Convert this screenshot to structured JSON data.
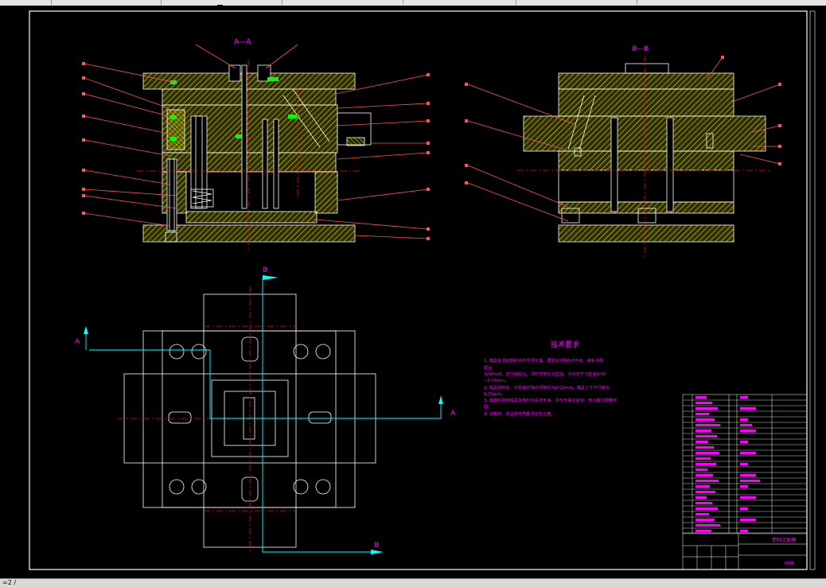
{
  "status": {
    "coord_text": "=2 /"
  },
  "sections": {
    "aa_label": "A—A",
    "bb_label": "B—B",
    "plan_b_top": "B",
    "plan_b_bottom": "B",
    "plan_a_left": "A",
    "plan_a_right": "A"
  },
  "tech": {
    "title": "技术要求",
    "lines": [
      "1. 模具各活动部件动作灵活可靠，要配合间隙为H7/f6，避免卡阻",
      "配合",
      "为H7/m6，定位销配合，顶杆顶部与分型面，允许低于分型面0.02",
      "~0.05mm。",
      "2. 模具组装后，分型面的接合间隙应为0.02mm，模具上下平行度为",
      "0.05mm。",
      "3. 装模时所有模具各部分应清洗干净，并吹干保证进给，开合模应顺畅无",
      "阻。",
      "4. 试模时，成品零件质量须达标合格。"
    ]
  },
  "title_block": {
    "design_name": "塑料注射模",
    "drawing_no": "000"
  },
  "colors": {
    "background": "#000000",
    "outline": "#ffffff",
    "section_fill": "#ffff00",
    "leader": "#ff5555",
    "centerline": "#ff0000",
    "section_line": "#00ffff",
    "text": "#ff00ff",
    "accent": "#00ff00"
  }
}
